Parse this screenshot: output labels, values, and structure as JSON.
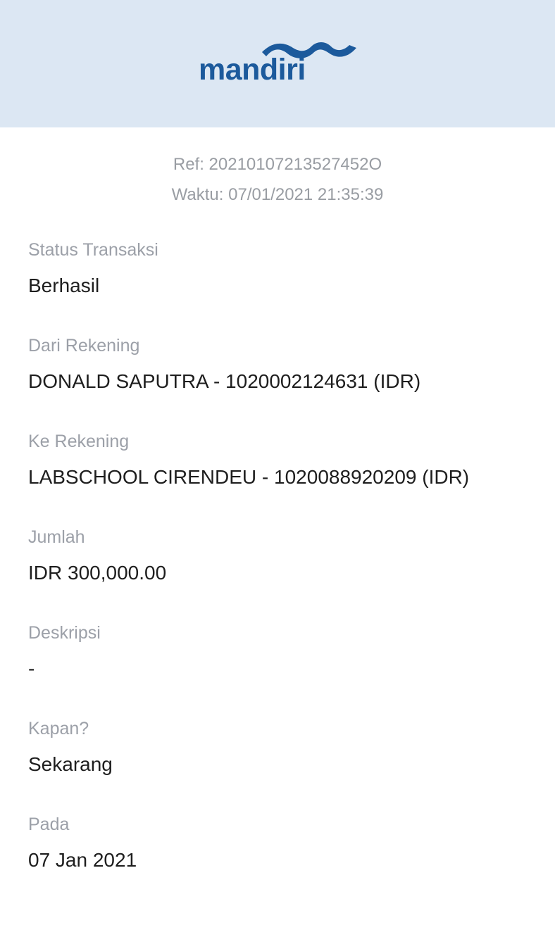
{
  "brand": {
    "name": "mandiri",
    "color": "#1c5a9c",
    "header_bg": "#dce7f3",
    "logo_icon": "mandiri-wave-logo"
  },
  "reference": {
    "ref": "Ref: 20210107213527452O",
    "time": "Waktu: 07/01/2021 21:35:39"
  },
  "details": [
    {
      "label": "Status Transaksi",
      "value": "Berhasil"
    },
    {
      "label": "Dari Rekening",
      "value": "DONALD SAPUTRA - 1020002124631 (IDR)"
    },
    {
      "label": "Ke Rekening",
      "value": "LABSCHOOL CIRENDEU - 1020088920209 (IDR)"
    },
    {
      "label": "Jumlah",
      "value": "IDR 300,000.00"
    },
    {
      "label": "Deskripsi",
      "value": "-"
    },
    {
      "label": "Kapan?",
      "value": "Sekarang"
    },
    {
      "label": "Pada",
      "value": "07 Jan 2021"
    }
  ]
}
